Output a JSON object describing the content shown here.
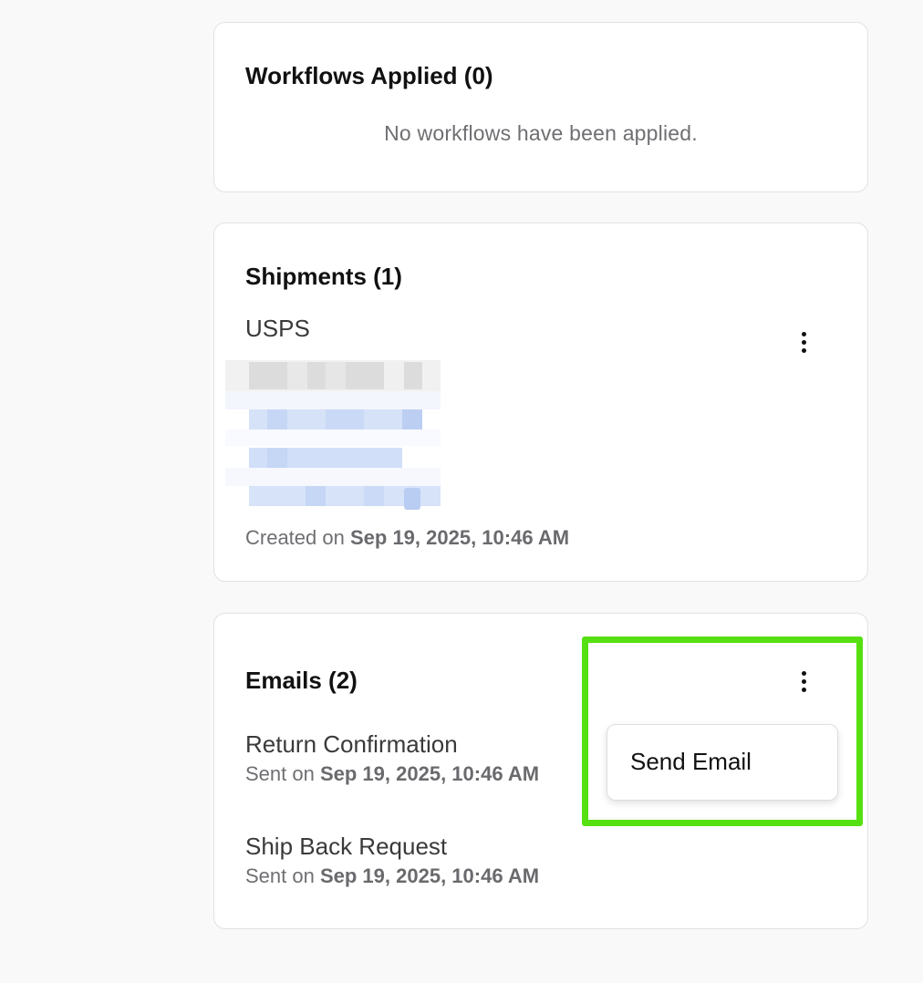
{
  "workflows": {
    "title": "Workflows Applied (0)",
    "empty_message": "No workflows have been applied."
  },
  "shipments": {
    "title": "Shipments (1)",
    "items": [
      {
        "carrier": "USPS",
        "created_prefix": "Created on",
        "created_date": "Sep 19, 2025, 10:46 AM"
      }
    ]
  },
  "emails": {
    "title": "Emails (2)",
    "items": [
      {
        "subject": "Return Confirmation",
        "sent_prefix": "Sent on",
        "sent_date": "Sep 19, 2025, 10:46 AM"
      },
      {
        "subject": "Ship Back Request",
        "sent_prefix": "Sent on",
        "sent_date": "Sep 19, 2025, 10:46 AM"
      }
    ],
    "menu": {
      "items": [
        {
          "label": "Send Email"
        }
      ]
    }
  },
  "icons": {
    "more": "more-vertical-icon"
  },
  "colors": {
    "highlight": "#56e011",
    "page_background": "#f9f9f9",
    "redaction_blue": "#cddcf7"
  }
}
